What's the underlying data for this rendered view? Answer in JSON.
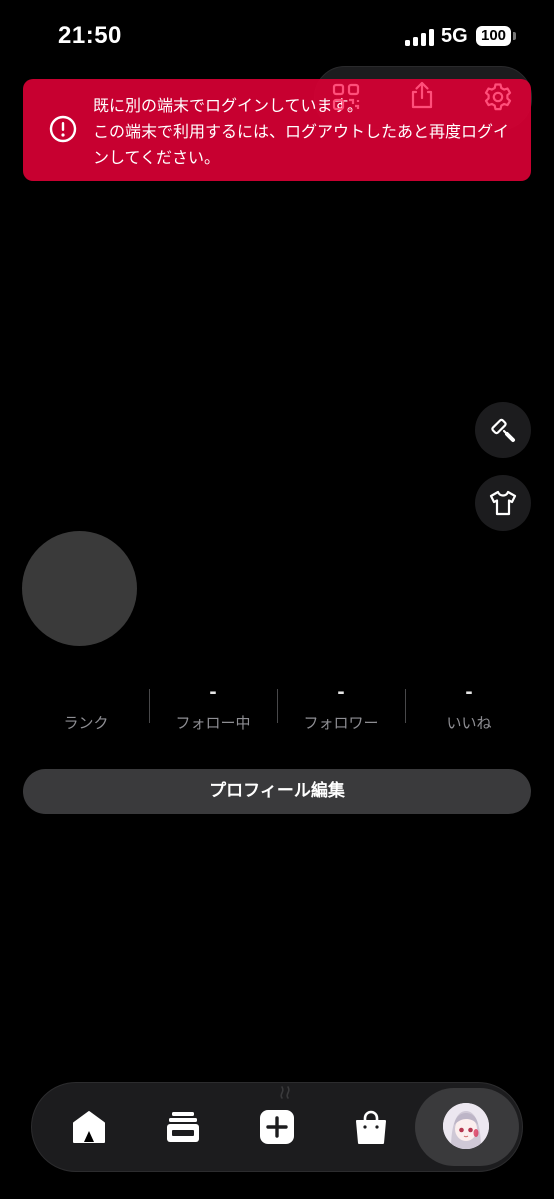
{
  "status_bar": {
    "time": "21:50",
    "network": "5G",
    "battery": "100"
  },
  "banner": {
    "line1": "既に別の端末でログインしています。",
    "line2": "この端末で利用するには、ログアウトしたあと再度ログインしてください。",
    "color": "#d60034",
    "icon": "alert-circle-icon"
  },
  "header_actions": [
    "qr-code-icon",
    "share-icon",
    "settings-icon"
  ],
  "side_actions": [
    "paint-roller-icon",
    "tshirt-icon"
  ],
  "stats": [
    {
      "value": "",
      "label": "ランク"
    },
    {
      "value": "-",
      "label": "フォロー中"
    },
    {
      "value": "-",
      "label": "フォロワー"
    },
    {
      "value": "-",
      "label": "いいね"
    }
  ],
  "edit_profile_label": "プロフィール編集",
  "tabs": [
    "home-icon",
    "stack-icon",
    "plus-icon",
    "bag-icon",
    "profile-avatar"
  ],
  "active_tab": "profile-avatar"
}
